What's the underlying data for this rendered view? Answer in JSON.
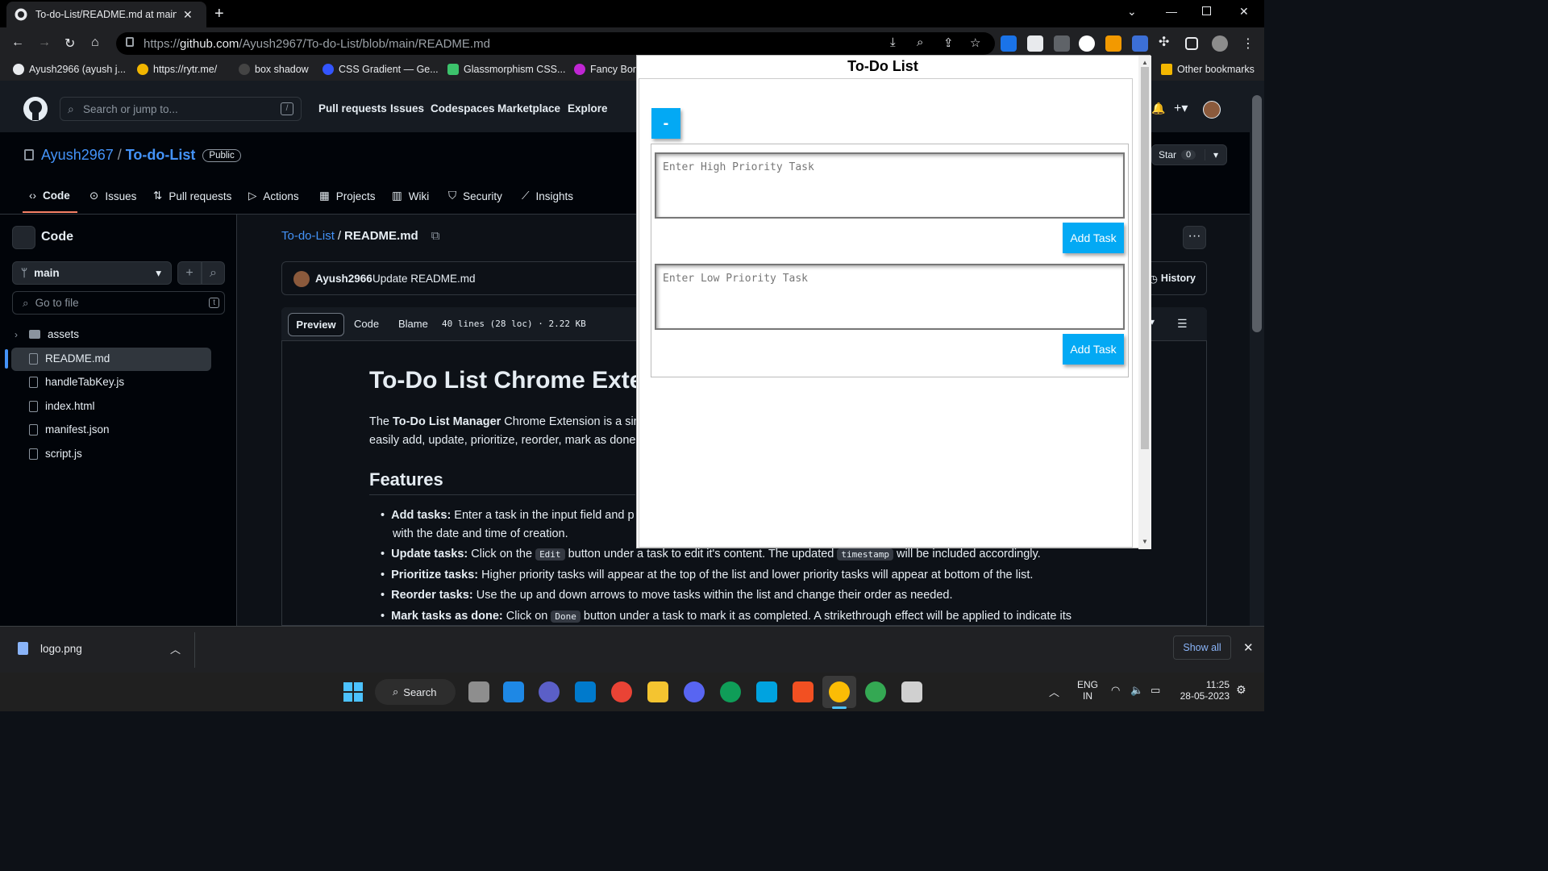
{
  "browser": {
    "tab_title": "To-do-List/README.md at main",
    "tab_close": "✕",
    "new_tab": "+",
    "url_prefix": "https://",
    "url_host": "github.com",
    "url_path": "/Ayush2967/To-do-List/blob/main/README.md",
    "bookmarks": [
      "Ayush2966 (ayush j...",
      "https://rytr.me/",
      "box shadow",
      "CSS Gradient — Ge...",
      "Glassmorphism CSS...",
      "Fancy Bor"
    ],
    "other_bookmarks": "Other bookmarks"
  },
  "github": {
    "search_placeholder": "Search or jump to...",
    "search_key": "/",
    "nav": [
      "Pull requests",
      "Issues",
      "Codespaces",
      "Marketplace",
      "Explore"
    ],
    "owner": "Ayush2967",
    "separator": "/",
    "repo": "To-do-List",
    "visibility": "Public",
    "star_label": "Star",
    "star_count": "0",
    "repo_tabs": [
      "Code",
      "Issues",
      "Pull requests",
      "Actions",
      "Projects",
      "Wiki",
      "Security",
      "Insights"
    ],
    "sidebar_title": "Code",
    "branch": "main",
    "goto_placeholder": "Go to file",
    "goto_key": "t",
    "files": [
      "assets",
      "README.md",
      "handleTabKey.js",
      "index.html",
      "manifest.json",
      "script.js"
    ],
    "breadcrumb_repo": "To-do-List",
    "breadcrumb_file": "README.md",
    "commit_author": "Ayush2966",
    "commit_message": "Update README.md",
    "history_label": "History",
    "view_tabs": [
      "Preview",
      "Code",
      "Blame"
    ],
    "file_meta": "40 lines (28 loc) · 2.22 KB",
    "readme": {
      "h1": "To-Do List Chrome Exten",
      "intro_1": "The ",
      "intro_bold": "To-Do List Manager",
      "intro_2": " Chrome Extension is a sim",
      "intro_line2": "easily add, update, prioritize, reorder, mark as done",
      "h2": "Features",
      "f1_bold": "Add tasks:",
      "f1_text": " Enter a task in the input field and p",
      "f1_line2": "with the date and time of creation.",
      "f2_bold": "Update tasks:",
      "f2_a": " Click on the ",
      "f2_code": "Edit",
      "f2_b": " button under a task to edit it's content. The updated ",
      "f2_code2": "timestamp",
      "f2_c": " will be included accordingly.",
      "f3_bold": "Prioritize tasks:",
      "f3_text": " Higher priority tasks will appear at the top of the list and lower priority tasks will appear at bottom of the list.",
      "f4_bold": "Reorder tasks:",
      "f4_text": " Use the up and down arrows to move tasks within the list and change their order as needed.",
      "f5_bold": "Mark tasks as done:",
      "f5_a": " Click on ",
      "f5_code": "Done",
      "f5_b": " button under a task to mark it as completed. A strikethrough effect will be applied to indicate its"
    }
  },
  "popup": {
    "title": "To-Do List",
    "minus_button": "-",
    "high_placeholder": "Enter High Priority Task",
    "low_placeholder": "Enter Low Priority Task",
    "add_high": "Add Task",
    "add_low": "Add Task"
  },
  "downloads": {
    "file": "logo.png",
    "show_all": "Show all"
  },
  "taskbar": {
    "search": "Search",
    "lang1": "ENG",
    "lang2": "IN",
    "time": "11:25",
    "date": "28-05-2023"
  },
  "colors": {
    "accent_blue": "#03a9f4",
    "github_link": "#4493f8"
  }
}
